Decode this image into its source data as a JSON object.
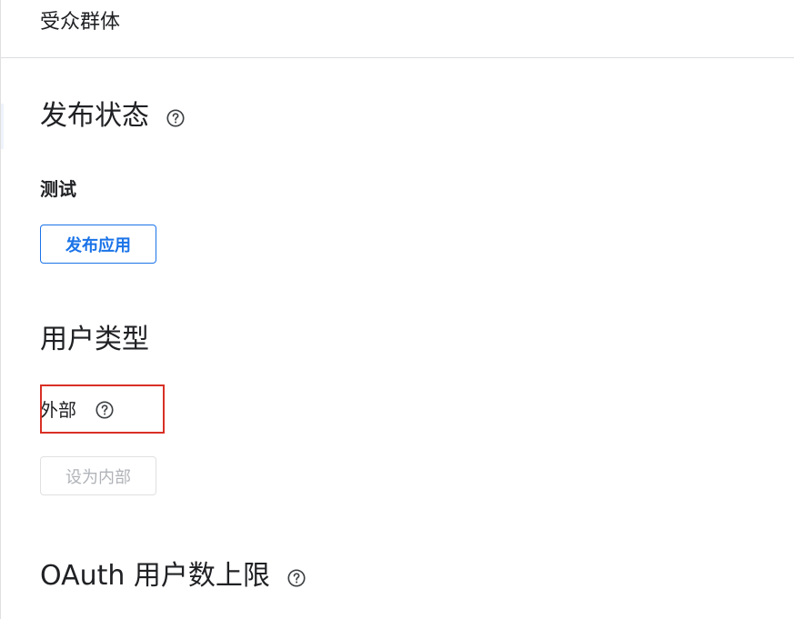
{
  "header": {
    "title": "受众群体"
  },
  "publishing_status": {
    "title": "发布状态",
    "help_icon": "help-circle-icon",
    "status_label": "测试",
    "publish_button_label": "发布应用"
  },
  "user_type": {
    "title": "用户类型",
    "value": "外部",
    "help_icon": "help-circle-icon",
    "make_internal_button_label": "设为内部",
    "make_internal_disabled": true
  },
  "oauth_user_cap": {
    "title": "OAuth 用户数上限",
    "help_icon": "help-circle-icon"
  },
  "colors": {
    "accent": "#1a73e8",
    "highlight": "#d93025",
    "disabled_text": "#b0b3b8",
    "divider": "#dadce0"
  }
}
